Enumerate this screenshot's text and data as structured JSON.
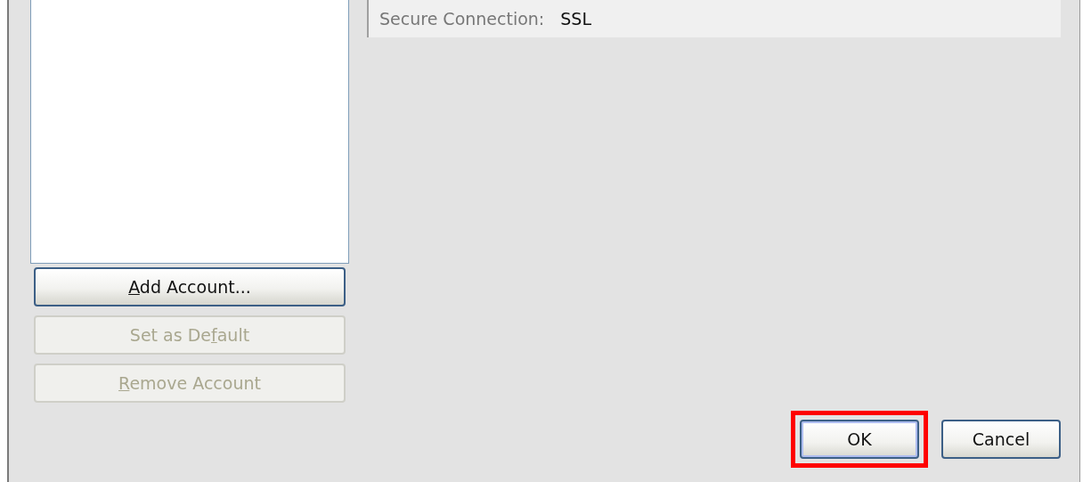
{
  "account_buttons": [
    {
      "access_key": "A",
      "label_after": "dd Account...",
      "disabled": false
    },
    {
      "label_before": "Set as De",
      "access_key": "f",
      "label_after": "ault",
      "disabled": true
    },
    {
      "access_key": "R",
      "label_after": "emove Account",
      "disabled": true
    }
  ],
  "details": [
    {
      "label": "Secure Connection:",
      "value": "SSL"
    }
  ],
  "dialog_buttons": [
    {
      "label": "OK",
      "default": true,
      "highlighted": true
    },
    {
      "label": "Cancel",
      "default": false,
      "highlighted": false
    }
  ]
}
